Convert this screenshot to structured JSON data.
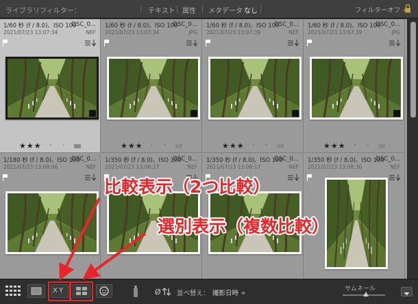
{
  "filterbar": {
    "title": "ライブラリフィルター：",
    "options": [
      "テキスト",
      "属性",
      "メタデータ",
      "なし"
    ],
    "active": "なし",
    "preset": "フィルターオフ ÷"
  },
  "cells": [
    {
      "meta": "1/60 秒 (f / 8.0)、ISO 100",
      "name": "DSC_0...",
      "date": "2021/07/23 13:07:34",
      "ext": "NEF",
      "stars": "★★★",
      "dots": "· ·",
      "selected": true
    },
    {
      "meta": "1/60 秒 (f / 8.0)、ISO 100",
      "name": "DSC_0...",
      "date": "2021/07/23 13:07:34",
      "ext": "JPG",
      "stars": "★★★",
      "dots": "· ·",
      "selected": false
    },
    {
      "meta": "1/60 秒 (f / 8.0)、ISO 100",
      "name": "DSC_0...",
      "date": "2021/07/23 13:07:39",
      "ext": "NEF",
      "stars": "★★★",
      "dots": "· ·",
      "selected": false
    },
    {
      "meta": "1/60 秒 (f / 8.0)、ISO 100",
      "name": "DSC_0...",
      "date": "2021/07/23 13:07:39",
      "ext": "JPG",
      "stars": "★★★",
      "dots": "· ·",
      "selected": false
    },
    {
      "meta": "1/180 秒 (f / 8.0)、ISO 100",
      "name": "DSC_0...",
      "date": "2021/07/23 13:08:06",
      "ext": "NEF",
      "stars": "",
      "dots": "",
      "selected": false
    },
    {
      "meta": "1/350 秒 (f / 8.0)、ISO 100",
      "name": "DSC_0...",
      "date": "2021/07/23 13:08:17",
      "ext": "NEF",
      "stars": "",
      "dots": "",
      "selected": false
    },
    {
      "meta": "1/350 秒 (f / 8.0)、ISO 100",
      "name": "DSC_0...",
      "date": "2021/07/23 13:08:17",
      "ext": "NEF",
      "stars": "",
      "dots": "",
      "selected": false
    },
    {
      "meta": "1/350 秒 (f / 8.0)、ISO 100",
      "name": "DSC_0...",
      "date": "2021/07/23 13:08:30",
      "ext": "NEF",
      "stars": "",
      "dots": "",
      "selected": false
    }
  ],
  "toolbar": {
    "sort_label": "並べ替え：",
    "sort_value": "撮影日時 ÷",
    "thumbnail_label": "サムネール",
    "thumbnail_size": 0.55,
    "compare_glyph": "X Y"
  },
  "annotations": {
    "compare": "比較表示（2つ比較）",
    "survey": "選別表示（複数比較）"
  },
  "colors": {
    "annotation": "#e8262a",
    "selected_cell": "#c4c4c4",
    "cell": "#9a9a9a"
  }
}
